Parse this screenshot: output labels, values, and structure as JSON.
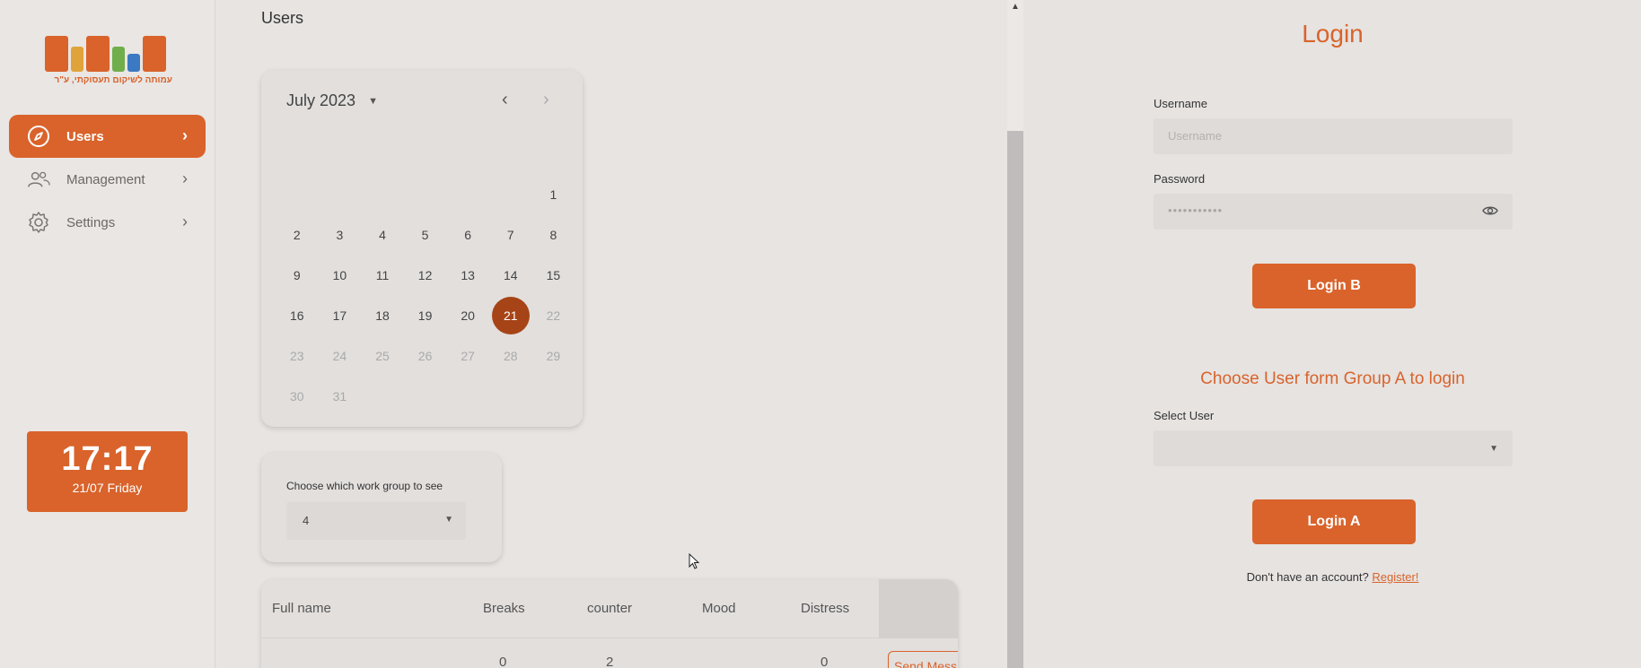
{
  "colors": {
    "accent": "#d9632b",
    "selected_day": "#a64417"
  },
  "sidebar": {
    "logo": {
      "tagline": "עמותה לשיקום תעסוקתי, ע\"ר"
    },
    "items": [
      {
        "label": "Users",
        "icon": "compass-icon",
        "active": true
      },
      {
        "label": "Management",
        "icon": "people-icon",
        "active": false
      },
      {
        "label": "Settings",
        "icon": "gear-icon",
        "active": false
      }
    ],
    "clock": {
      "time": "17:17",
      "date": "21/07 Friday"
    }
  },
  "main": {
    "title": "Users",
    "calendar": {
      "month_label": "July 2023",
      "weeks": [
        [
          "",
          "",
          "",
          "",
          "",
          "",
          "1"
        ],
        [
          "2",
          "3",
          "4",
          "5",
          "6",
          "7",
          "8"
        ],
        [
          "9",
          "10",
          "11",
          "12",
          "13",
          "14",
          "15"
        ],
        [
          "16",
          "17",
          "18",
          "19",
          "20",
          "21",
          "22"
        ],
        [
          "23",
          "24",
          "25",
          "26",
          "27",
          "28",
          "29"
        ],
        [
          "30",
          "31",
          "",
          "",
          "",
          "",
          ""
        ]
      ],
      "selected_day": "21",
      "first_disabled_day": 22
    },
    "workgroup": {
      "label": "Choose which work group to see",
      "value": "4"
    },
    "table": {
      "columns": [
        "Full name",
        "Breaks",
        "counter",
        "Mood",
        "Distress"
      ],
      "peek_row": {
        "breaks": "0",
        "counter": "2",
        "distress": "0",
        "action": "Send Message"
      }
    }
  },
  "login": {
    "title": "Login",
    "username": {
      "label": "Username",
      "placeholder": "Username"
    },
    "password": {
      "label": "Password",
      "value": "•••••••••••"
    },
    "login_b": "Login B",
    "group_title": "Choose User form Group A to login",
    "select_user": {
      "label": "Select User",
      "value": ""
    },
    "login_a": "Login A",
    "register_prompt": "Don't have an account?",
    "register_link": "Register!"
  }
}
